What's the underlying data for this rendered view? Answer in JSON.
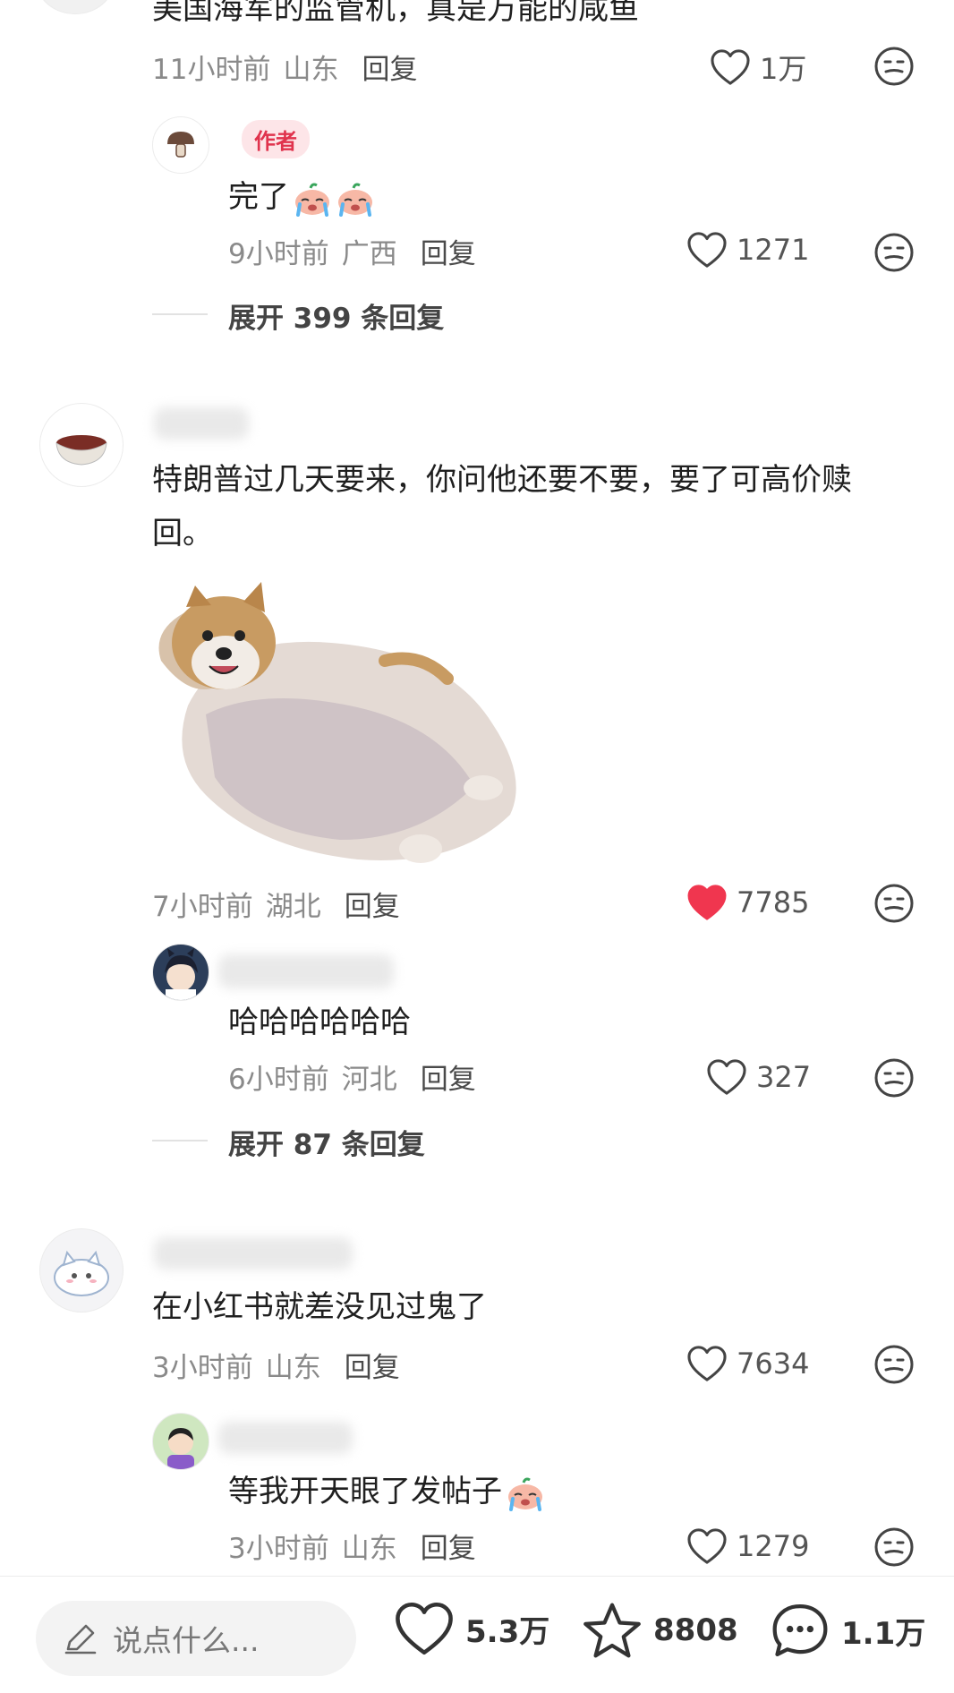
{
  "comments": [
    {
      "text": "美国海军的监管机，真是万能的咸鱼",
      "time": "11小时前",
      "location": "山东",
      "reply_label": "回复",
      "likes": "1万",
      "liked": false,
      "replies": [
        {
          "author_tag": "作者",
          "text": "完了",
          "time": "9小时前",
          "location": "广西",
          "reply_label": "回复",
          "likes": "1271",
          "liked": false
        }
      ],
      "expand_label": "展开 399 条回复"
    },
    {
      "text_line1": "特朗普过几天要来，你问他还要不要，要了可高价赎",
      "text_line2": "回。",
      "time": "7小时前",
      "location": "湖北",
      "reply_label": "回复",
      "likes": "7785",
      "liked": true,
      "replies": [
        {
          "text": "哈哈哈哈哈哈",
          "time": "6小时前",
          "location": "河北",
          "reply_label": "回复",
          "likes": "327",
          "liked": false
        }
      ],
      "expand_label": "展开 87 条回复"
    },
    {
      "text": "在小红书就差没见过鬼了",
      "time": "3小时前",
      "location": "山东",
      "reply_label": "回复",
      "likes": "7634",
      "liked": false,
      "replies": [
        {
          "text": "等我开天眼了发帖子",
          "time": "3小时前",
          "location": "山东",
          "reply_label": "回复",
          "likes": "1279",
          "liked": false
        }
      ]
    }
  ],
  "bottom_bar": {
    "input_placeholder": "说点什么...",
    "likes": "5.3万",
    "collects": "8808",
    "comments": "1.1万"
  },
  "colors": {
    "liked_heart": "#f0364f",
    "author_tag_bg": "#fde5e8",
    "author_tag_text": "#e0334d",
    "meta_gray": "#8a8a8a"
  },
  "icons": [
    "heart-icon",
    "dislike-face-icon",
    "pencil-icon",
    "star-icon",
    "chat-bubble-icon"
  ]
}
